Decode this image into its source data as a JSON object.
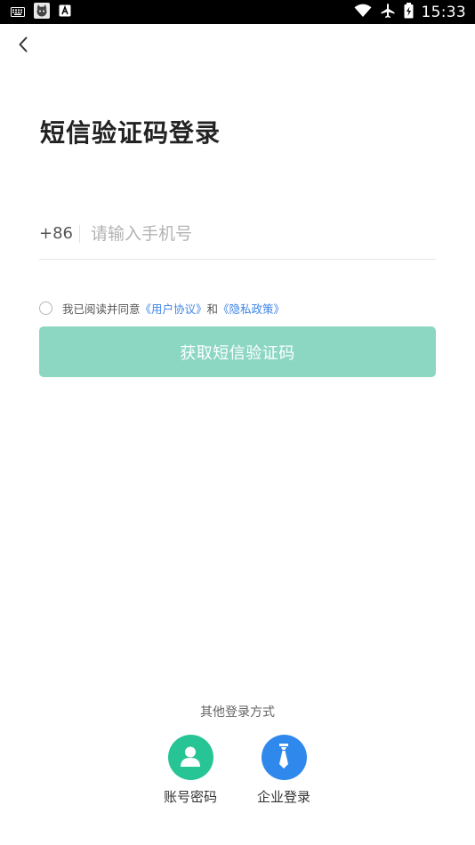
{
  "status_bar": {
    "time": "15:33",
    "icons": [
      "keyboard-icon",
      "cat-notification-icon",
      "font-notification-icon",
      "wifi-icon",
      "airplane-icon",
      "battery-icon"
    ]
  },
  "header": {
    "back_icon": "chevron-left-icon",
    "title": "短信验证码登录"
  },
  "phone_form": {
    "country_code": "+86",
    "input_placeholder": "请输入手机号",
    "input_value": ""
  },
  "agreement": {
    "prefix": "我已阅读并同意",
    "user_agreement": "《用户协议》",
    "conjunction": "和",
    "privacy_policy": "《隐私政策》"
  },
  "submit": {
    "label": "获取短信验证码"
  },
  "other_login": {
    "title": "其他登录方式",
    "options": [
      {
        "label": "账号密码",
        "icon": "user-icon",
        "color": "#27c495"
      },
      {
        "label": "企业登录",
        "icon": "tie-icon",
        "color": "#2f88ec"
      }
    ]
  },
  "colors": {
    "accent_button": "#8bd7c2",
    "link": "#3f86e8",
    "title": "#222222"
  }
}
